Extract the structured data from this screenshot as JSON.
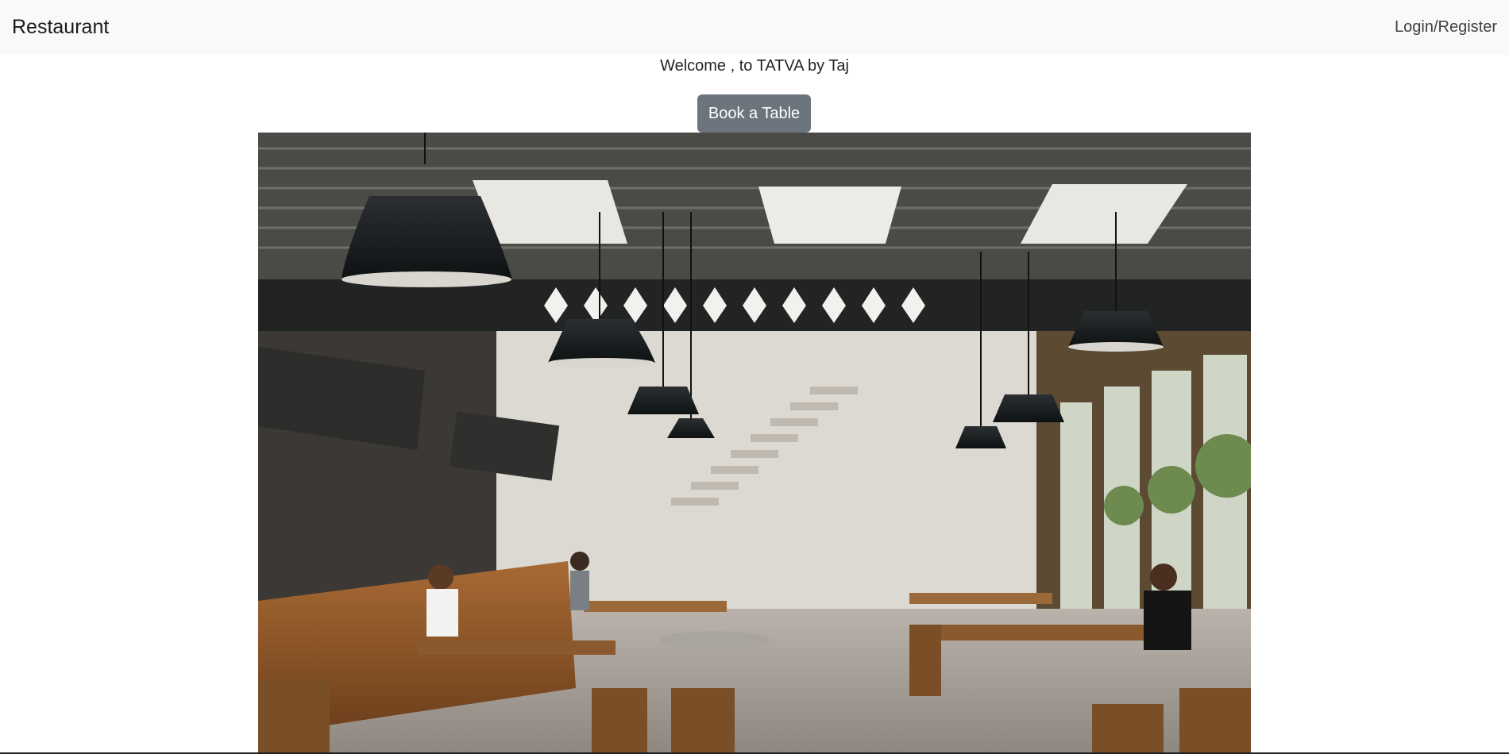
{
  "navbar": {
    "brand": "Restaurant",
    "login_label": "Login/Register"
  },
  "main": {
    "welcome_text": "Welcome , to TATVA by Taj",
    "book_button_label": "Book a Table",
    "hero_image": {
      "description_icon": "restaurant-interior-photo"
    }
  },
  "colors": {
    "navbar_bg": "#f8f9fa",
    "button_bg": "#6c757d",
    "button_text": "#ffffff"
  }
}
